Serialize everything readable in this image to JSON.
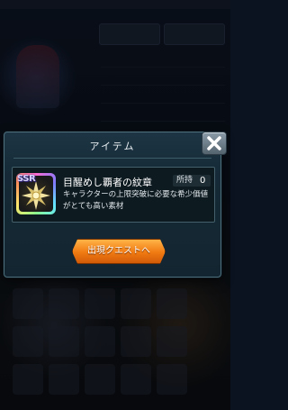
{
  "dialog": {
    "title": "アイテム",
    "close_icon": "close-x-icon"
  },
  "item": {
    "rarity": "SSR",
    "name": "目醒めし覇者の紋章",
    "owned_label": "所持",
    "owned_count": "0",
    "description": "キャラクターの上限突破に必要な希少価値がとても高い素材",
    "icon": "crest-emblem-icon"
  },
  "actions": {
    "quest_button": "出現クエストへ"
  },
  "colors": {
    "dialog_bg": "#152a36",
    "button_orange": "#f07a12",
    "rarity_gradient": "rainbow"
  }
}
